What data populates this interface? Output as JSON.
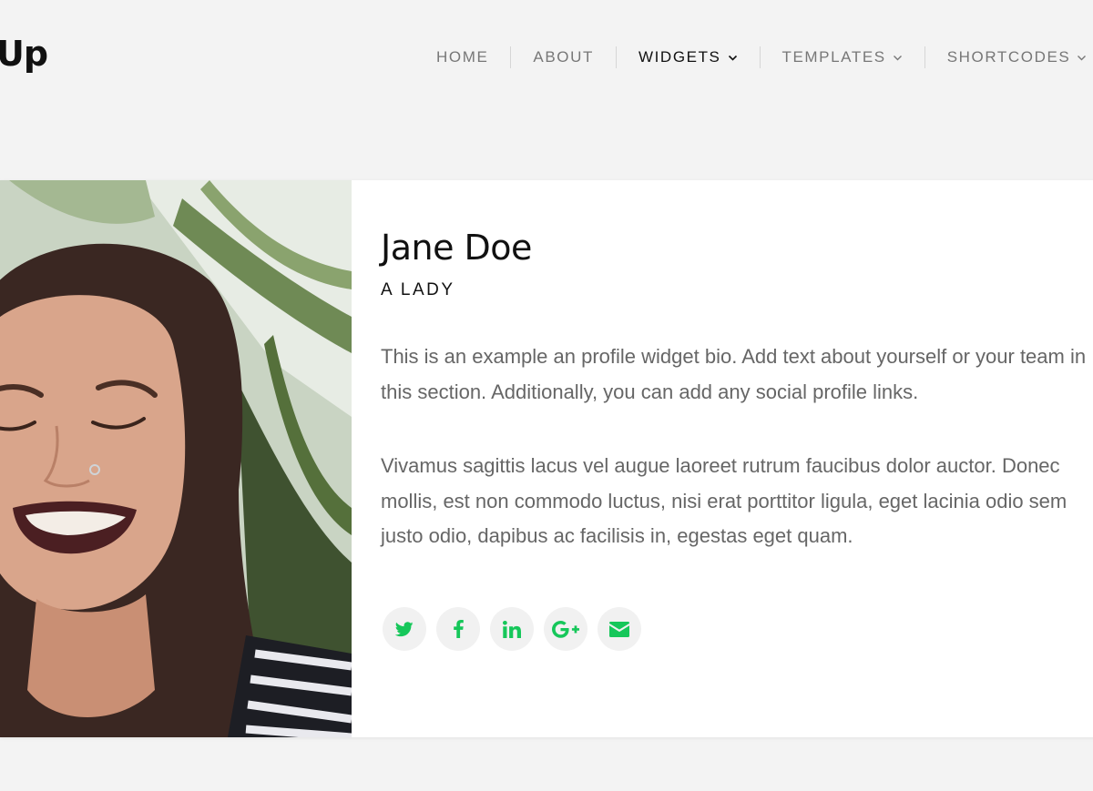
{
  "brand": {
    "logo_text": "Up"
  },
  "nav": {
    "items": [
      {
        "label": "HOME",
        "dropdown": false,
        "active": false
      },
      {
        "label": "ABOUT",
        "dropdown": false,
        "active": false
      },
      {
        "label": "WIDGETS",
        "dropdown": true,
        "active": true
      },
      {
        "label": "TEMPLATES",
        "dropdown": true,
        "active": false
      },
      {
        "label": "SHORTCODES",
        "dropdown": true,
        "active": false
      }
    ]
  },
  "profile": {
    "photo_icon": "person-photo",
    "name": "Jane Doe",
    "role": "A LADY",
    "bio": [
      "This is an example an profile widget bio. Add text about yourself or your team in",
      "this section. Additionally, you can add any social profile links.",
      "Vivamus sagittis lacus vel augue laoreet rutrum faucibus dolor auctor. Donec",
      "mollis, est non commodo luctus, nisi erat porttitor ligula, eget lacinia odio sem",
      "justo odio, dapibus ac facilisis in, egestas eget quam."
    ],
    "social": [
      {
        "icon": "twitter-icon"
      },
      {
        "icon": "facebook-icon"
      },
      {
        "icon": "linkedin-icon"
      },
      {
        "icon": "google-plus-icon"
      },
      {
        "icon": "email-icon"
      }
    ]
  },
  "colors": {
    "background": "#f3f3f3",
    "card": "#ffffff",
    "accent": "#16c75a",
    "nav_text": "#777777",
    "nav_active": "#111111",
    "body_text": "#666666"
  }
}
